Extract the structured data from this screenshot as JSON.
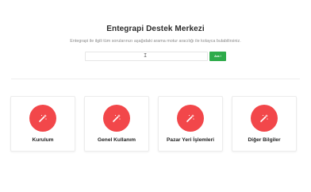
{
  "hero": {
    "title": "Entegrapi Destek Merkezi",
    "subtitle": "Entegrapi ile ilgili tüm sorularınızı aşağıdaki arama motur aracılığı ile kolayca bulabilirsiniz.",
    "search": {
      "value": "",
      "placeholder": "",
      "button_label": "Ara !"
    }
  },
  "colors": {
    "accent": "#f2474a",
    "button": "#2eab4a"
  },
  "cards": [
    {
      "label": "Kurulum",
      "icon": "magic-wand-icon"
    },
    {
      "label": "Genel Kullanım",
      "icon": "magic-wand-icon"
    },
    {
      "label": "Pazar Yeri İşlemleri",
      "icon": "magic-wand-icon"
    },
    {
      "label": "Diğer Bilgiler",
      "icon": "magic-wand-icon"
    }
  ]
}
